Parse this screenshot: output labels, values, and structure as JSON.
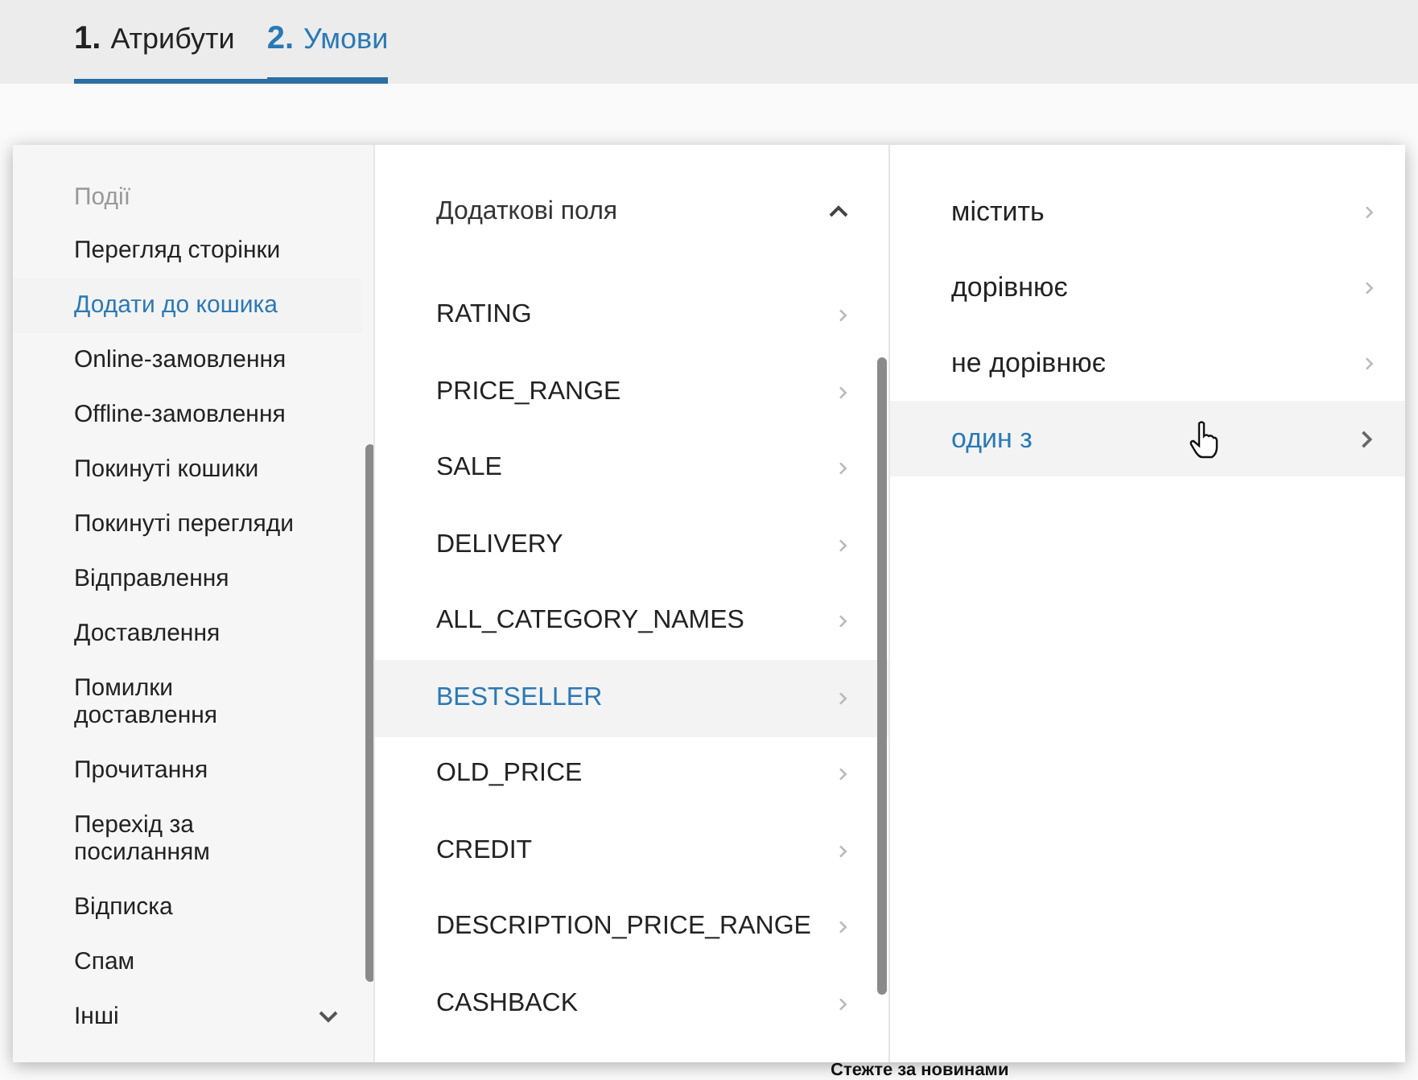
{
  "tabs": [
    {
      "number": "1.",
      "label": "Атрибути",
      "selected": false
    },
    {
      "number": "2.",
      "label": "Умови",
      "selected": true
    }
  ],
  "events": {
    "header": "Події",
    "items": [
      {
        "label": "Перегляд сторінки",
        "selected": false
      },
      {
        "label": "Додати до кошика",
        "selected": true
      },
      {
        "label": "Online-замовлення",
        "selected": false
      },
      {
        "label": "Offline-замовлення",
        "selected": false
      },
      {
        "label": "Покинуті кошики",
        "selected": false
      },
      {
        "label": "Покинуті перегляди",
        "selected": false
      },
      {
        "label": "Відправлення",
        "selected": false
      },
      {
        "label": "Доставлення",
        "selected": false
      },
      {
        "label": "Помилки доставлення",
        "selected": false
      },
      {
        "label": "Прочитання",
        "selected": false
      },
      {
        "label": "Перехід за посиланням",
        "selected": false
      },
      {
        "label": "Відписка",
        "selected": false
      },
      {
        "label": "Спам",
        "selected": false
      }
    ],
    "more": {
      "label": "Інші",
      "expanded": false
    }
  },
  "fields": {
    "group": {
      "label": "Додаткові поля",
      "expanded": true
    },
    "items": [
      {
        "label": "RATING",
        "selected": false
      },
      {
        "label": "PRICE_RANGE",
        "selected": false
      },
      {
        "label": "SALE",
        "selected": false
      },
      {
        "label": "DELIVERY",
        "selected": false
      },
      {
        "label": "ALL_CATEGORY_NAMES",
        "selected": false
      },
      {
        "label": "BESTSELLER",
        "selected": true
      },
      {
        "label": "OLD_PRICE",
        "selected": false
      },
      {
        "label": "CREDIT",
        "selected": false
      },
      {
        "label": "DESCRIPTION_PRICE_RANGE",
        "selected": false
      },
      {
        "label": "CASHBACK",
        "selected": false
      }
    ]
  },
  "conditions": [
    {
      "label": "містить",
      "selected": false
    },
    {
      "label": "дорівнює",
      "selected": false
    },
    {
      "label": "не дорівнює",
      "selected": false
    },
    {
      "label": "один з",
      "selected": true
    }
  ],
  "footer_text": "Стежте за новинами"
}
